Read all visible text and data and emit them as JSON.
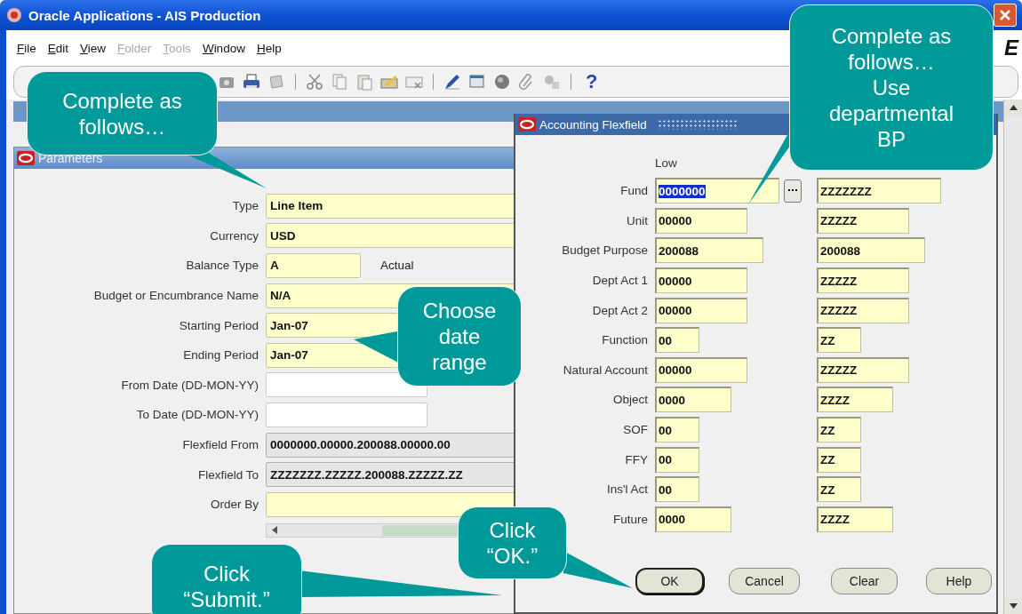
{
  "window": {
    "title": "Oracle Applications - AIS Production"
  },
  "menu": [
    {
      "label": "File",
      "disabled": false
    },
    {
      "label": "Edit",
      "disabled": false
    },
    {
      "label": "View",
      "disabled": false
    },
    {
      "label": "Folder",
      "disabled": true
    },
    {
      "label": "Tools",
      "disabled": true
    },
    {
      "label": "Window",
      "disabled": false
    },
    {
      "label": "Help",
      "disabled": false
    }
  ],
  "brand_fragment": "E",
  "toolbar": {
    "help": "?"
  },
  "parameters": {
    "title": "Parameters",
    "fields": [
      {
        "label": "Type",
        "value": "Line Item",
        "kind": "long"
      },
      {
        "label": "Currency",
        "value": "USD",
        "kind": "long"
      },
      {
        "label": "Balance Type",
        "value": "A",
        "kind": "short",
        "description": "Actual"
      },
      {
        "label": "Budget or Encumbrance Name",
        "value": "N/A",
        "kind": "long"
      },
      {
        "label": "Starting Period",
        "value": "Jan-07",
        "kind": "long"
      },
      {
        "label": "Ending Period",
        "value": "Jan-07",
        "kind": "long"
      },
      {
        "label": "From Date (DD-MON-YY)",
        "kind": "date"
      },
      {
        "label": "To Date (DD-MON-YY)",
        "kind": "date"
      },
      {
        "label": "Flexfield From",
        "value": "0000000.00000.200088.00000.00",
        "kind": "flex"
      },
      {
        "label": "Flexfield To",
        "value": "ZZZZZZZ.ZZZZZ.200088.ZZZZZ.ZZ",
        "kind": "flex"
      },
      {
        "label": "Order By",
        "kind": "long"
      }
    ]
  },
  "flexfield": {
    "title": "Accounting Flexfield",
    "column_label": "Low",
    "segments": [
      {
        "label": "Fund",
        "low": "0000000",
        "high": "ZZZZZZZ",
        "low_selected": true,
        "lov": true
      },
      {
        "label": "Unit",
        "low": "00000",
        "high": "ZZZZZ",
        "low_selected": false,
        "lov": false
      },
      {
        "label": "Budget Purpose",
        "low": "200088",
        "high": "200088",
        "low_selected": false,
        "lov": false
      },
      {
        "label": "Dept Act 1",
        "low": "00000",
        "high": "ZZZZZ",
        "low_selected": false,
        "lov": false
      },
      {
        "label": "Dept Act 2",
        "low": "00000",
        "high": "ZZZZZ",
        "low_selected": false,
        "lov": false
      },
      {
        "label": "Function",
        "low": "00",
        "high": "ZZ",
        "low_selected": false,
        "lov": false
      },
      {
        "label": "Natural Account",
        "low": "00000",
        "high": "ZZZZZ",
        "low_selected": false,
        "lov": false
      },
      {
        "label": "Object",
        "low": "0000",
        "high": "ZZZZ",
        "low_selected": false,
        "lov": false
      },
      {
        "label": "SOF",
        "low": "00",
        "high": "ZZ",
        "low_selected": false,
        "lov": false
      },
      {
        "label": "FFY",
        "low": "00",
        "high": "ZZ",
        "low_selected": false,
        "lov": false
      },
      {
        "label": "Ins'l Act",
        "low": "00",
        "high": "ZZ",
        "low_selected": false,
        "lov": false
      },
      {
        "label": "Future",
        "low": "0000",
        "high": "ZZZZ",
        "low_selected": false,
        "lov": false
      }
    ],
    "buttons": [
      {
        "label": "OK",
        "default": true
      },
      {
        "label": "Cancel",
        "default": false
      },
      {
        "label": "Clear",
        "default": false
      },
      {
        "label": "Help",
        "default": false
      }
    ]
  },
  "callouts": [
    {
      "text": "Complete as follows…"
    },
    {
      "text": "Complete as follows…\nUse departmental BP"
    },
    {
      "text": "Choose date range"
    },
    {
      "text": "Click “OK.”"
    },
    {
      "text": "Click “Submit.”"
    }
  ]
}
